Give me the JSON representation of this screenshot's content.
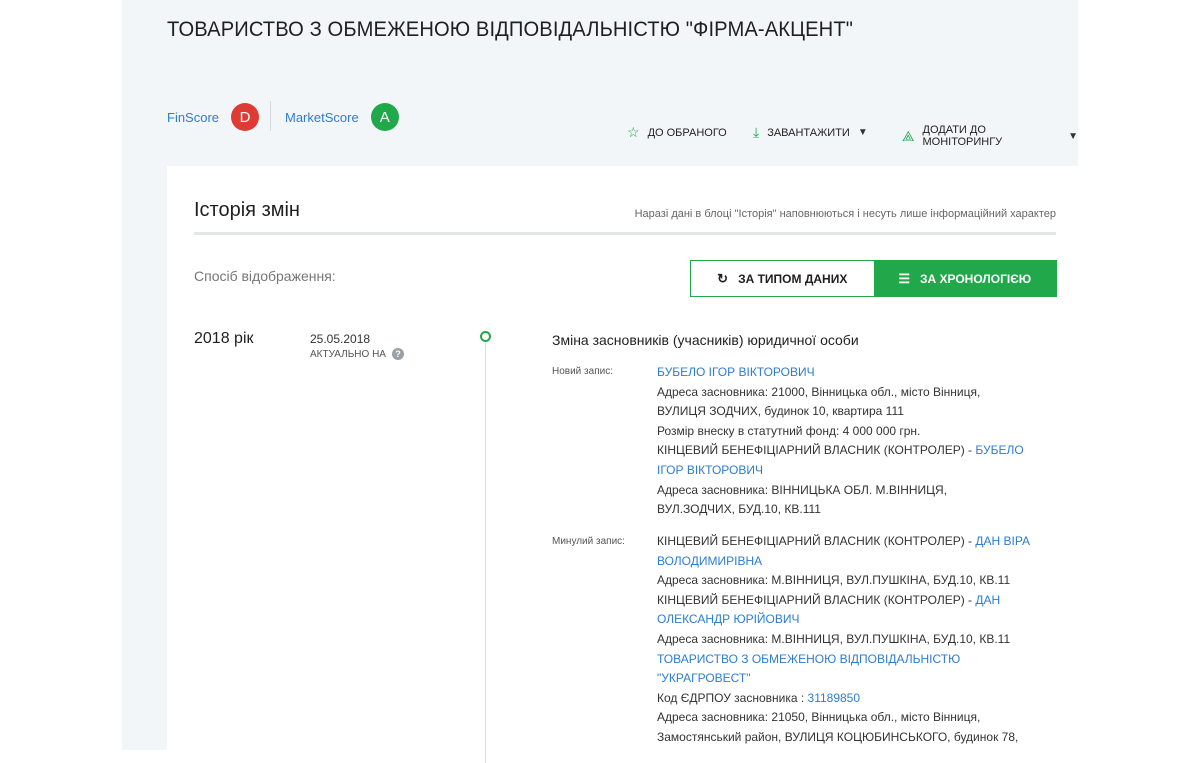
{
  "header": {
    "company_title": "ТОВАРИСТВО З ОБМЕЖЕНОЮ ВІДПОВІДАЛЬНІСТЮ \"ФІРМА-АКЦЕНТ\"",
    "finscore_label": "FinScore",
    "finscore_grade": "D",
    "marketscore_label": "MarketScore",
    "marketscore_grade": "A"
  },
  "actions": {
    "favorite": "До обраного",
    "download": "Завантажити",
    "monitoring": "Додати до моніторингу"
  },
  "history": {
    "title": "Історія змін",
    "note": "Наразі дані в блоці \"Історія\" наповнюються і несуть лише інформаційний характер",
    "mode_label": "Спосіб відображення:",
    "by_type": "За типом даних",
    "by_chronology": "За хронологією"
  },
  "entry": {
    "year": "2018 рік",
    "date": "25.05.2018",
    "actual_label": "АКТУАЛЬНО НА",
    "help": "?",
    "title": "Зміна засновників (учасників) юридичної особи",
    "new_label": "Новий запис:",
    "old_label": "Минулий запис:",
    "new_record": {
      "founder_name": "БУБЕЛО ІГОР ВІКТОРОВИЧ",
      "address_line1": "Адреса засновника: 21000, Вінницька обл., місто Вінниця,",
      "address_line2": "ВУЛИЦЯ ЗОДЧИХ, будинок 10, квартира 111",
      "contribution": "Розмір внеску в статутний фонд: 4 000 000 грн.",
      "beneficiary_prefix": "КІНЦЕВИЙ БЕНЕФІЦІАРНИЙ ВЛАСНИК (КОНТРОЛЕР) - ",
      "beneficiary_name_a": "БУБЕЛО",
      "beneficiary_name_b": "ІГОР ВІКТОРОВИЧ",
      "ben_address_line1": "Адреса засновника: ВІННИЦЬКА ОБЛ. М.ВІННИЦЯ,",
      "ben_address_line2": "ВУЛ.ЗОДЧИХ, БУД.10, КВ.111"
    },
    "old_record": {
      "ben1_prefix": "КІНЦЕВИЙ БЕНЕФІЦІАРНИЙ ВЛАСНИК (КОНТРОЛЕР) - ",
      "ben1_name_a": "ДАН ВІРА",
      "ben1_name_b": "ВОЛОДИМИРІВНА",
      "ben1_address": "Адреса засновника: М.ВІННИЦЯ, ВУЛ.ПУШКІНА, БУД.10, КВ.11",
      "ben2_prefix": "КІНЦЕВИЙ БЕНЕФІЦІАРНИЙ ВЛАСНИК (КОНТРОЛЕР) - ",
      "ben2_name_a": "ДАН",
      "ben2_name_b": "ОЛЕКСАНДР ЮРІЙОВИЧ",
      "ben2_address": "Адреса засновника: М.ВІННИЦЯ, ВУЛ.ПУШКІНА, БУД.10, КВ.11",
      "company_line1": "ТОВАРИСТВО З ОБМЕЖЕНОЮ ВІДПОВІДАЛЬНІСТЮ",
      "company_line2": "\"УКРАГРОВЕСТ\"",
      "edrpou_prefix": "Код ЄДРПОУ засновника : ",
      "edrpou_code": "31189850",
      "company_address_line1": "Адреса засновника: 21050, Вінницька обл., місто Вінниця,",
      "company_address_line2": "Замостянський район, ВУЛИЦЯ КОЦЮБИНСЬКОГО, будинок 78,"
    }
  },
  "colors": {
    "green": "#21a84a",
    "red": "#dd3b34",
    "link": "#2e7cd0"
  }
}
